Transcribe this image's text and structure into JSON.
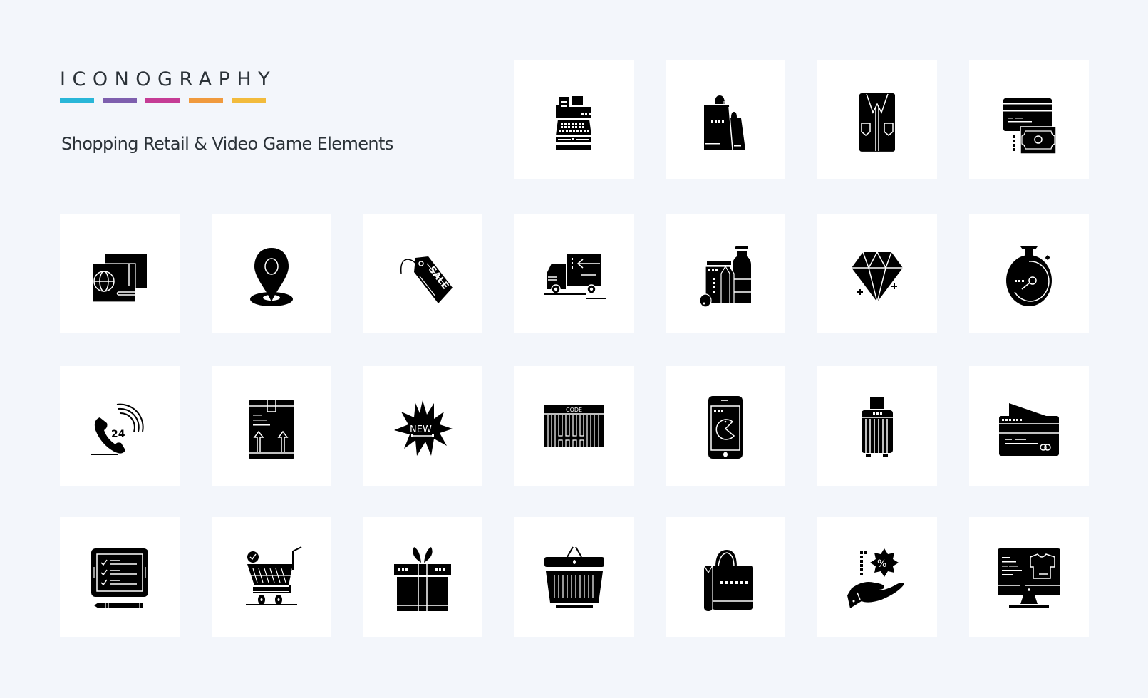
{
  "header": {
    "brand": "ICONOGRAPHY",
    "brand_bar_colors": [
      "#29b6d8",
      "#7e5fae",
      "#c53c95",
      "#f09a3e",
      "#f2bb3c"
    ],
    "subtitle": "Shopping Retail & Video Game Elements"
  },
  "icon_grid": {
    "rows": [
      [
        "cash-register",
        "shopping-bags",
        "shirt",
        "card-and-cash"
      ],
      [
        "passport",
        "location-pin",
        "sale-tag",
        "delivery-truck",
        "grocery-products",
        "diamond",
        "stopwatch"
      ],
      [
        "24-hour-support",
        "package-box",
        "new-badge",
        "barcode",
        "mobile-game",
        "luggage",
        "credit-card"
      ],
      [
        "tablet-checklist",
        "shopping-cart-check",
        "gift-box",
        "shopping-basket",
        "shopping-bag",
        "discount-offer-hand",
        "online-clothing-store"
      ]
    ],
    "texts": {
      "sale_tag": "SALE",
      "support_hours": "24",
      "new_badge": "NEW",
      "barcode_label": "CODE",
      "discount_symbol": "%"
    },
    "icon_color": "#000000",
    "tile_color": "#ffffff"
  }
}
